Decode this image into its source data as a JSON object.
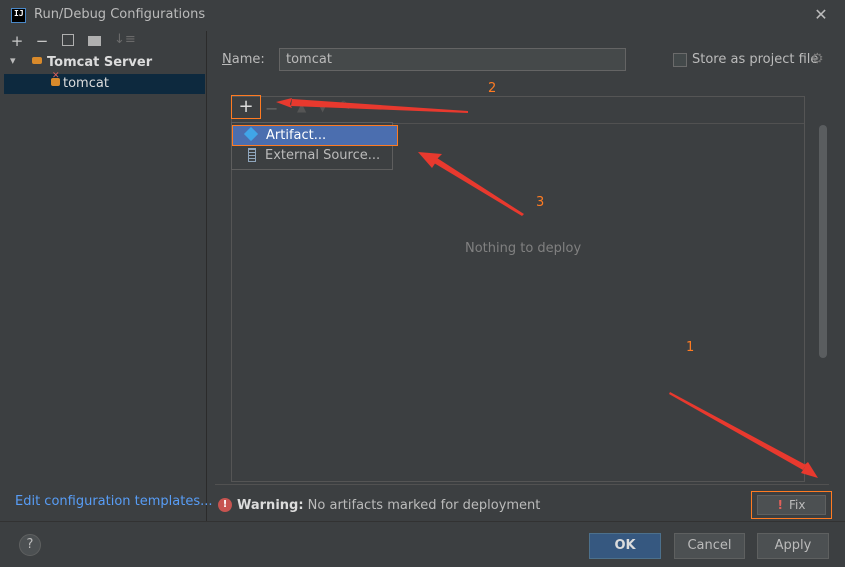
{
  "window": {
    "title": "Run/Debug Configurations",
    "app_icon_text": "IJ"
  },
  "left_toolbar": {
    "add": "+",
    "remove": "−"
  },
  "tree": {
    "root_label": "Tomcat Server",
    "child_label": "tomcat"
  },
  "edit_templates": "Edit configuration templates...",
  "name": {
    "label_underlined": "N",
    "label_rest": "ame:",
    "value": "tomcat"
  },
  "store": {
    "label": "Store as project file",
    "checked": false
  },
  "deployment": {
    "add_label": "+",
    "remove_label": "−",
    "empty_text": "Nothing to deploy"
  },
  "popup": {
    "items": [
      {
        "label": "Artifact...",
        "icon": "artifact-icon",
        "selected": true
      },
      {
        "label": "External Source...",
        "icon": "external-source-icon",
        "selected": false
      }
    ]
  },
  "warning": {
    "bold": "Warning:",
    "message": "No artifacts marked for deployment"
  },
  "fix": {
    "label": "Fix"
  },
  "buttons": {
    "ok": "OK",
    "cancel": "Cancel",
    "apply": "Apply",
    "help": "?"
  },
  "annotations": [
    "1",
    "2",
    "3"
  ],
  "colors": {
    "accent": "#ff7b22",
    "arrow": "#e8392e",
    "selection": "#4b6eaf",
    "link": "#589df6"
  }
}
